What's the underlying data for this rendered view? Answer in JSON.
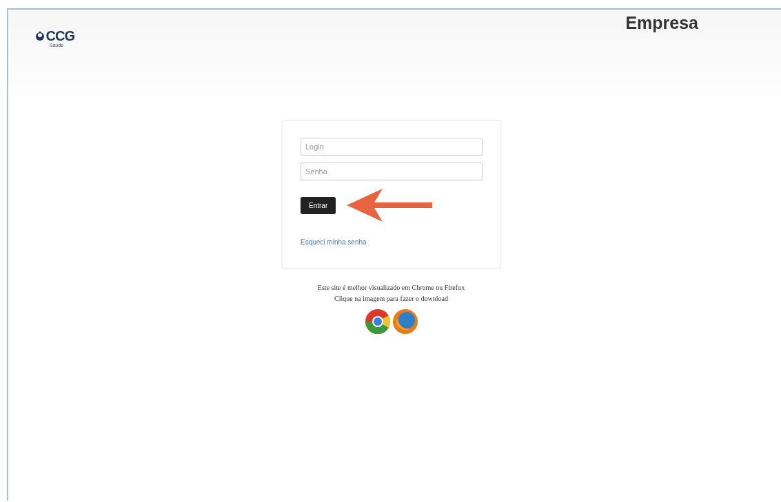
{
  "header": {
    "logo_text": "CCG",
    "logo_subtext": "Saúde",
    "title": "Empresa"
  },
  "login_form": {
    "login": {
      "placeholder": "Login"
    },
    "password": {
      "placeholder": "Senha"
    },
    "submit": "Entrar",
    "forgot_link": "Esqueci minha senha"
  },
  "browser_note": {
    "lines": [
      "Este site é melhor visualizado em Chrome ou Firefox",
      "Clique na imagem para fazer o download"
    ]
  }
}
